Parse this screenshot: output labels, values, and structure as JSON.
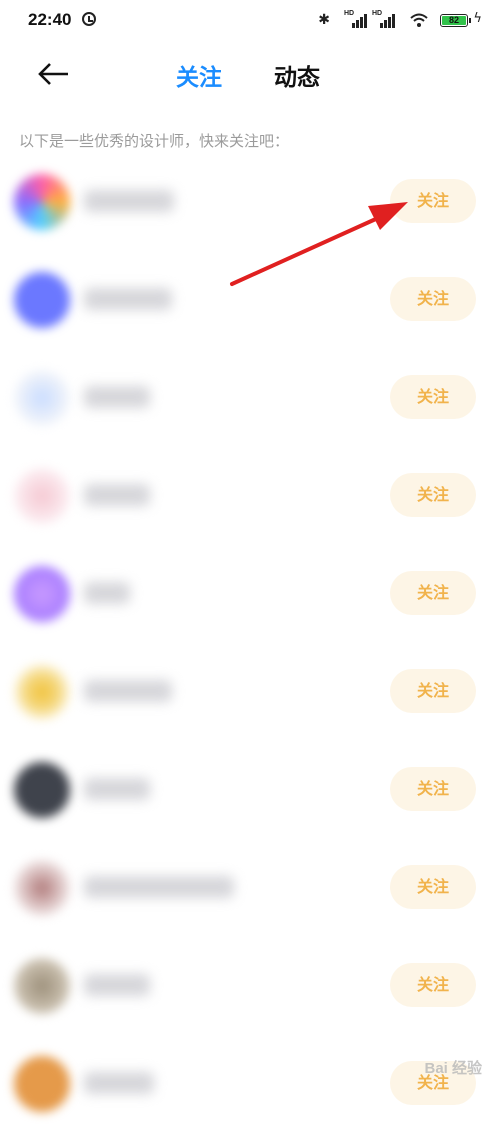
{
  "status_bar": {
    "time": "22:40",
    "battery": "82",
    "icons": [
      "alarm-icon",
      "bluetooth-icon",
      "hd-signal-icon",
      "hd-signal-icon",
      "wifi-icon",
      "battery-icon",
      "charging-icon"
    ]
  },
  "nav": {
    "back_icon": "back-arrow-icon",
    "tabs": [
      {
        "label": "关注",
        "active": true,
        "color": "#1a8cff"
      },
      {
        "label": "动态",
        "active": false,
        "color": "#111111"
      }
    ]
  },
  "hint": "以下是一些优秀的设计师，快来关注吧：",
  "designers": [
    {
      "follow_label": "关注"
    },
    {
      "follow_label": "关注"
    },
    {
      "follow_label": "关注"
    },
    {
      "follow_label": "关注"
    },
    {
      "follow_label": "关注"
    },
    {
      "follow_label": "关注"
    },
    {
      "follow_label": "关注"
    },
    {
      "follow_label": "关注"
    },
    {
      "follow_label": "关注"
    },
    {
      "follow_label": "关注"
    }
  ],
  "colors": {
    "accent": "#1a8cff",
    "follow_text": "#f1b34c",
    "follow_bg": "#fdf5e6",
    "annotation": "#e02020"
  },
  "watermark": "Bai 经验"
}
